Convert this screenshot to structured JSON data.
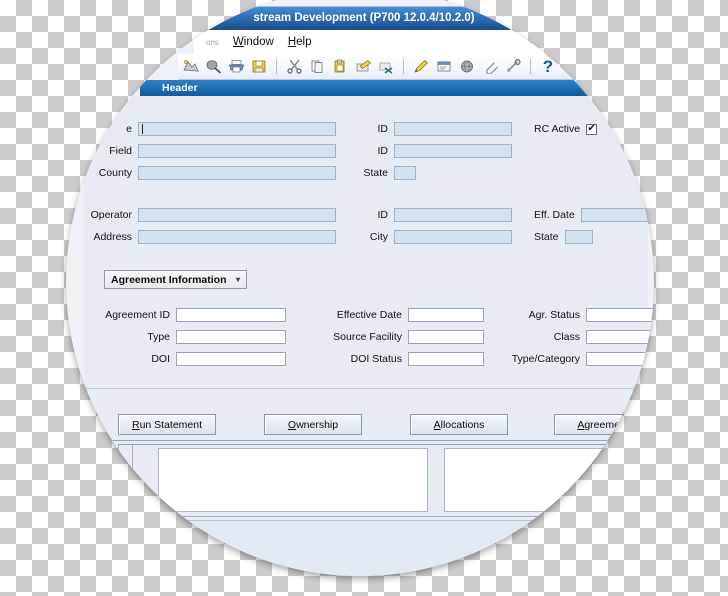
{
  "window": {
    "title": "stream Development (P700 12.0.4/10.2.0)",
    "header_band_label": "Header"
  },
  "menubar": {
    "items": [
      {
        "name": "truncated-menu",
        "label": "ons",
        "faded": true
      },
      {
        "name": "window",
        "label": "Window",
        "accel": "W"
      },
      {
        "name": "help",
        "label": "Help",
        "accel": "H"
      }
    ]
  },
  "toolbar": {
    "icons": [
      {
        "name": "new-icon",
        "glyph": "✦"
      },
      {
        "name": "find-icon",
        "glyph": "🔍"
      },
      {
        "name": "print-icon",
        "glyph": "🖨"
      },
      {
        "name": "save-icon",
        "glyph": "💾"
      },
      {
        "name": "cut-icon",
        "glyph": "✂"
      },
      {
        "name": "copy-icon",
        "glyph": "📄"
      },
      {
        "name": "paste-icon",
        "glyph": "📋"
      },
      {
        "name": "edit-record-icon",
        "glyph": "✎"
      },
      {
        "name": "delete-record-icon",
        "glyph": "🗑"
      },
      {
        "name": "insert-record-icon",
        "glyph": "✐"
      },
      {
        "name": "next-block-icon",
        "glyph": "🗔"
      },
      {
        "name": "globe-icon",
        "glyph": "🌐"
      },
      {
        "name": "attachment-icon",
        "glyph": "📎"
      },
      {
        "name": "tools-icon",
        "glyph": "⚙"
      },
      {
        "name": "help-icon",
        "glyph": "?"
      }
    ]
  },
  "header_form": {
    "fields": [
      {
        "name": "name",
        "label": "e",
        "value": "",
        "id_label": "ID",
        "id_value": ""
      },
      {
        "name": "field",
        "label": "Field",
        "value": "",
        "id_label": "ID",
        "id_value": ""
      },
      {
        "name": "county",
        "label": "County",
        "value": "",
        "state_label": "State",
        "state_value": ""
      }
    ],
    "rc_active": {
      "label": "RC Active",
      "checked": true,
      "mark": "✔"
    },
    "operator": {
      "label": "Operator",
      "value": "",
      "id_label": "ID",
      "id_value": "",
      "eff_date_label": "Eff. Date",
      "eff_date_value": ""
    },
    "address": {
      "label": "Address",
      "value": "",
      "city_label": "City",
      "city_value": "",
      "state_label": "State",
      "state_value": ""
    }
  },
  "section_selector": {
    "label": "Agreement Information",
    "arrow": "▾"
  },
  "agreement_form": {
    "left": [
      {
        "name": "agreement-id",
        "label": "Agreement ID",
        "value": ""
      },
      {
        "name": "type",
        "label": "Type",
        "value": ""
      },
      {
        "name": "doi",
        "label": "DOI",
        "value": ""
      }
    ],
    "middle": [
      {
        "name": "effective-date",
        "label": "Effective Date",
        "value": ""
      },
      {
        "name": "source-facility",
        "label": "Source Facility",
        "value": ""
      },
      {
        "name": "doi-status",
        "label": "DOI Status",
        "value": ""
      }
    ],
    "right": [
      {
        "name": "agr-status",
        "label": "Agr. Status",
        "value": ""
      },
      {
        "name": "class",
        "label": "Class",
        "value": ""
      },
      {
        "name": "type-category",
        "label": "Type/Category",
        "value": "",
        "extra_value": ""
      }
    ]
  },
  "buttons": [
    {
      "name": "run-statement-button",
      "label": "Run Statement",
      "accel": "R"
    },
    {
      "name": "ownership-button",
      "label": "Ownership",
      "accel": "O"
    },
    {
      "name": "allocations-button",
      "label": "Allocations",
      "accel": "A"
    },
    {
      "name": "agreement-button",
      "label": "Agreement",
      "accel": "A"
    }
  ],
  "colors": {
    "titlebar_blue": "#1d4f8d",
    "band_blue": "#1b6cb3",
    "field_fill": "#d4e2f0",
    "canvas": "#e7ecf4"
  }
}
